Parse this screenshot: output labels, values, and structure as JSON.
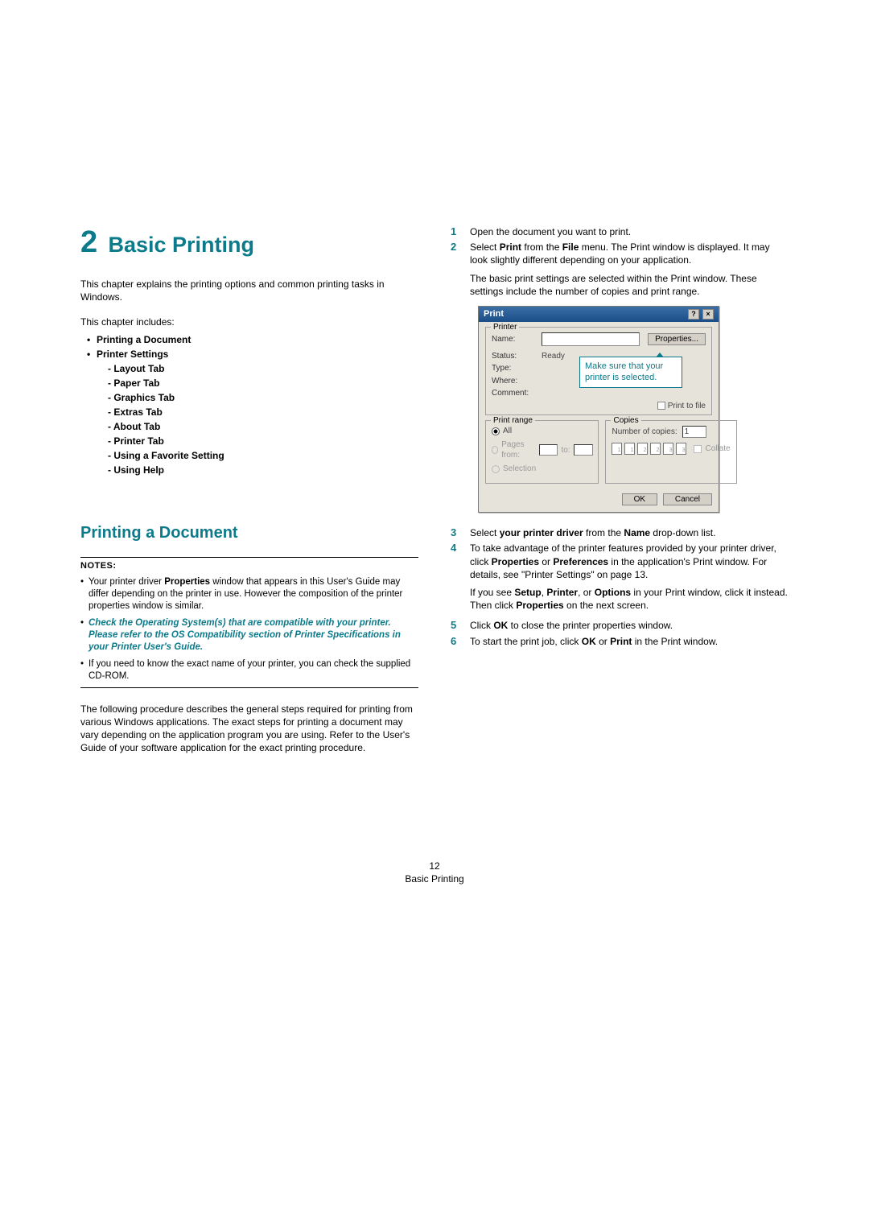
{
  "chapter": {
    "number": "2",
    "title": "Basic Printing",
    "intro": "This chapter explains the printing options and common printing tasks in Windows.",
    "includes_label": "This chapter includes:",
    "toc": [
      "Printing a Document",
      "Printer Settings"
    ],
    "sub_toc": [
      "- Layout Tab",
      "- Paper Tab",
      "- Graphics Tab",
      "- Extras Tab",
      "- About Tab",
      "- Printer Tab",
      "- Using a Favorite Setting",
      "- Using Help"
    ]
  },
  "section": {
    "heading": "Printing a Document",
    "notes_label": "NOTES",
    "notes": [
      {
        "html": "Your printer driver <b>Properties</b> window that appears in this User's Guide may differ depending on the printer in use. However the composition of the printer properties window is similar."
      },
      {
        "link": "Check the Operating System(s) that are compatible with your printer. Please refer to the OS Compatibility section of Printer Specifications in your Printer User's Guide."
      },
      {
        "html": "If you need to know the exact name of your printer, you can check the supplied CD-ROM."
      }
    ],
    "after_notes": "The following procedure describes the general steps required for printing from various Windows applications. The exact steps for printing a document may vary depending on the application program you are using. Refer to the User's Guide of your software application for the exact printing procedure."
  },
  "steps": {
    "s1": "Open the document you want to print.",
    "s2a": "Select <b>Print</b> from the <b>File</b> menu. The Print window is displayed. It may look slightly different depending on your application.",
    "s2b": "The basic print settings are selected within the Print window. These settings include the number of copies and print range.",
    "s3": "Select <b>your printer driver</b> from the <b>Name</b> drop-down list.",
    "s4a": "To take advantage of the printer features provided by your printer driver, click <b>Properties</b> or <b>Preferences</b> in the application's Print window. For details, see \"Printer Settings\" on page 13.",
    "s4b": "If you see <b>Setup</b>, <b>Printer</b>, or <b>Options</b> in your Print window, click it instead. Then click <b>Properties</b> on the next screen.",
    "s5": "Click <b>OK</b> to close the printer properties window.",
    "s6": "To start the print job, click <b>OK</b> or <b>Print</b> in the Print window.",
    "nums": {
      "n1": "1",
      "n2": "2",
      "n3": "3",
      "n4": "4",
      "n5": "5",
      "n6": "6"
    }
  },
  "dlg": {
    "title": "Print",
    "help_btn": "?",
    "close_btn": "×",
    "printer_grp": "Printer",
    "name_lbl": "Name:",
    "properties_btn": "Properties...",
    "status_lbl": "Status:",
    "status_val": "Ready",
    "type_lbl": "Type:",
    "where_lbl": "Where:",
    "comment_lbl": "Comment:",
    "print_to_file": "Print to file",
    "range_grp": "Print range",
    "range_all": "All",
    "range_pages": "Pages   from:",
    "range_to": "to:",
    "range_sel": "Selection",
    "copies_grp": "Copies",
    "copies_lbl": "Number of copies:",
    "copies_val": "1",
    "collate_lbl": "Collate",
    "ok": "OK",
    "cancel": "Cancel",
    "callout": "Make sure that your printer is selected."
  },
  "footer": {
    "page_num": "12",
    "section": "Basic Printing"
  }
}
